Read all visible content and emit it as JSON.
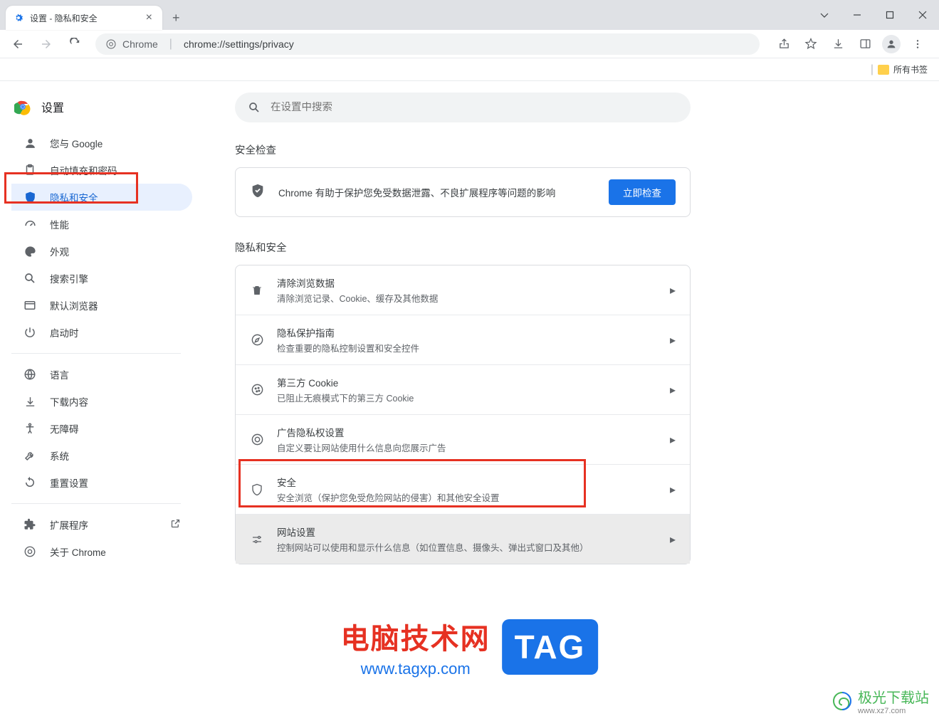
{
  "tab": {
    "title": "设置 - 隐私和安全"
  },
  "address": {
    "label": "Chrome",
    "url": "chrome://settings/privacy"
  },
  "bookmarks": {
    "all": "所有书签"
  },
  "app": {
    "title": "设置"
  },
  "search": {
    "placeholder": "在设置中搜索"
  },
  "sidebar": {
    "items": [
      {
        "label": "您与 Google"
      },
      {
        "label": "自动填充和密码"
      },
      {
        "label": "隐私和安全"
      },
      {
        "label": "性能"
      },
      {
        "label": "外观"
      },
      {
        "label": "搜索引擎"
      },
      {
        "label": "默认浏览器"
      },
      {
        "label": "启动时"
      }
    ],
    "group2": [
      {
        "label": "语言"
      },
      {
        "label": "下载内容"
      },
      {
        "label": "无障碍"
      },
      {
        "label": "系统"
      },
      {
        "label": "重置设置"
      }
    ],
    "group3": [
      {
        "label": "扩展程序"
      },
      {
        "label": "关于 Chrome"
      }
    ]
  },
  "sections": {
    "safety": {
      "title": "安全检查",
      "text": "Chrome 有助于保护您免受数据泄露、不良扩展程序等问题的影响",
      "button": "立即检查"
    },
    "privacy": {
      "title": "隐私和安全",
      "rows": [
        {
          "title": "清除浏览数据",
          "sub": "清除浏览记录、Cookie、缓存及其他数据"
        },
        {
          "title": "隐私保护指南",
          "sub": "检查重要的隐私控制设置和安全控件"
        },
        {
          "title": "第三方 Cookie",
          "sub": "已阻止无痕模式下的第三方 Cookie"
        },
        {
          "title": "广告隐私权设置",
          "sub": "自定义要让网站使用什么信息向您展示广告"
        },
        {
          "title": "安全",
          "sub": "安全浏览（保护您免受危险网站的侵害）和其他安全设置"
        },
        {
          "title": "网站设置",
          "sub": "控制网站可以使用和显示什么信息（如位置信息、摄像头、弹出式窗口及其他）"
        }
      ]
    }
  },
  "watermark": {
    "line1": "电脑技术网",
    "line2": "www.tagxp.com",
    "tag": "TAG",
    "corner": "极光下载站",
    "corner_sub": "www.xz7.com"
  }
}
